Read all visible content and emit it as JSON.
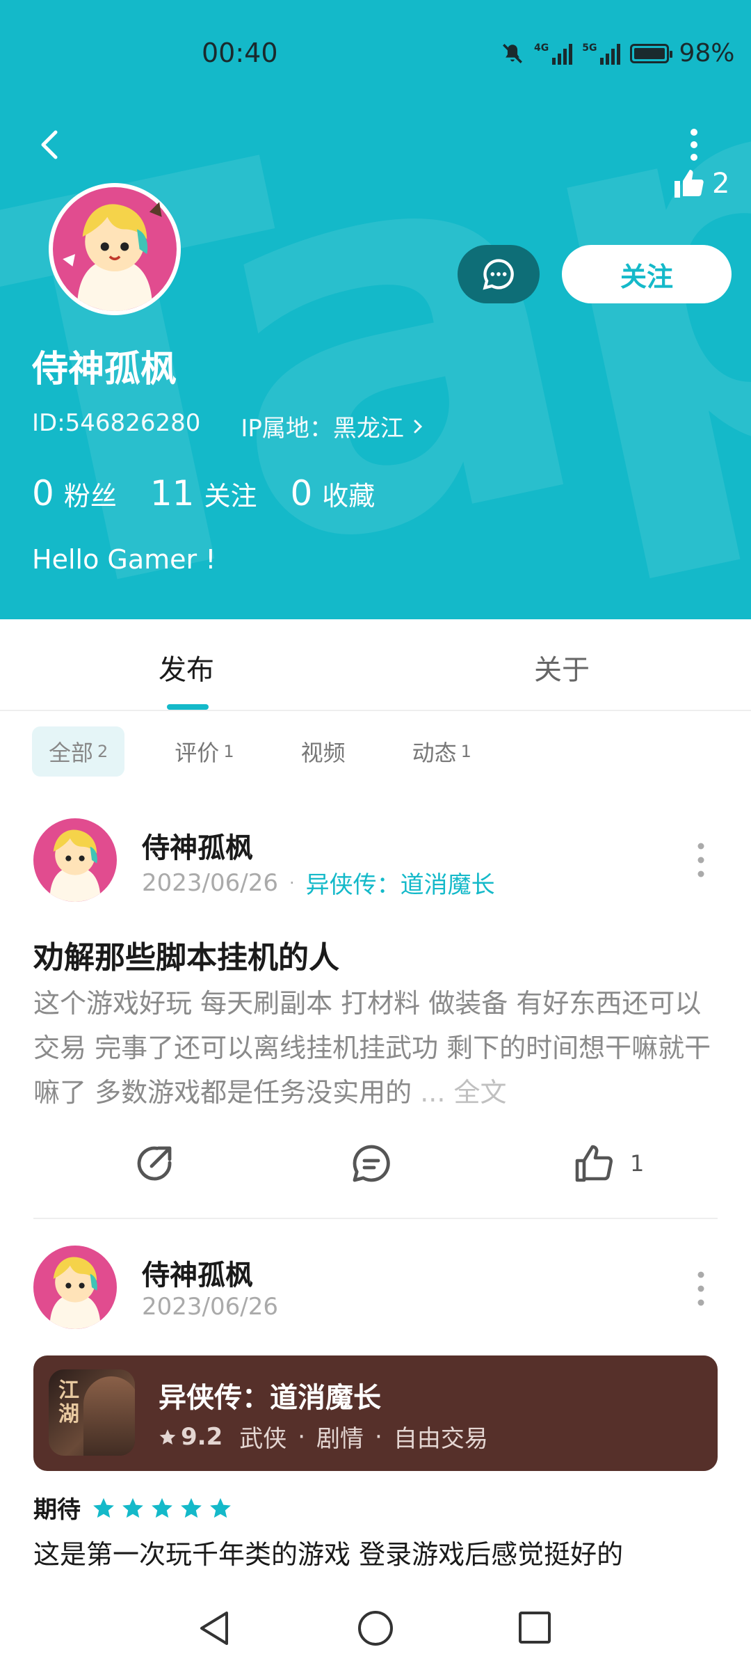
{
  "status_bar": {
    "time": "00:40",
    "battery": "98%",
    "net1": "4G",
    "net2": "5G"
  },
  "profile": {
    "likes": "2",
    "follow_label": "关注",
    "nickname": "侍神孤枫",
    "id_text": "ID:546826280",
    "ip_text": "IP属地：黑龙江",
    "stats": [
      {
        "num": "0",
        "label": "粉丝"
      },
      {
        "num": "11",
        "label": "关注"
      },
      {
        "num": "0",
        "label": "收藏"
      }
    ],
    "bio": "Hello Gamer !"
  },
  "tabs": [
    {
      "label": "发布"
    },
    {
      "label": "关于"
    }
  ],
  "chips": [
    {
      "label": "全部",
      "count": "2"
    },
    {
      "label": "评价",
      "count": "1"
    },
    {
      "label": "视频",
      "count": ""
    },
    {
      "label": "动态",
      "count": "1"
    }
  ],
  "post1": {
    "author": "侍神孤枫",
    "date": "2023/06/26",
    "game": "异侠传：道消魔长",
    "title": "劝解那些脚本挂机的人",
    "body": "这个游戏好玩 每天刷副本 打材料 做装备 有好东西还可以交易 完事了还可以离线挂机挂武功 剩下的时间想干嘛就干嘛了 多数游戏都是任务没实用的",
    "ellipsis": "...",
    "more": "全文",
    "like_count": "1"
  },
  "post2": {
    "author": "侍神孤枫",
    "date": "2023/06/26",
    "game_card": {
      "title": "异侠传：道消魔长",
      "rating": "9.2",
      "tags": [
        "武侠",
        "剧情",
        "自由交易"
      ],
      "icon_text": "江湖"
    },
    "rating_label": "期待",
    "stars": 5,
    "body": "这是第一次玩千年类的游戏 登录游戏后感觉挺好的"
  },
  "colors": {
    "accent": "#14b9c9",
    "card_bg": "#56302a",
    "dark_btn": "#0e6e77"
  }
}
